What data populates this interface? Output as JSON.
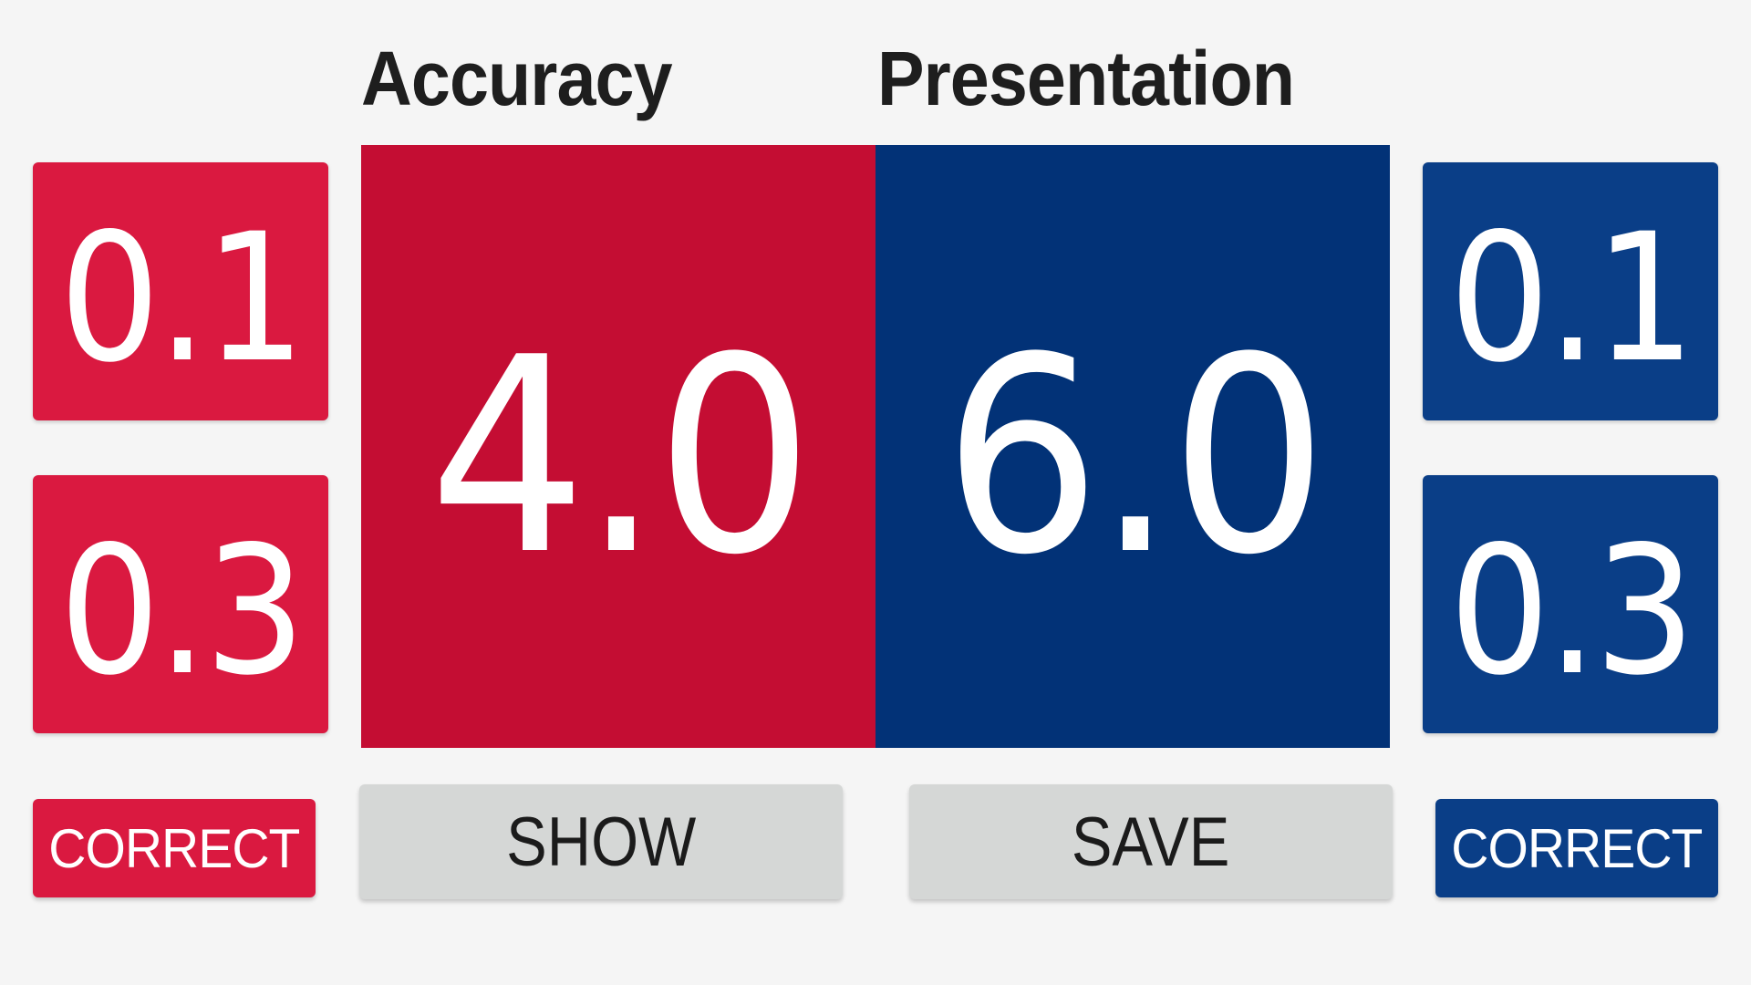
{
  "headings": {
    "accuracy": "Accuracy",
    "presentation": "Presentation"
  },
  "scores": {
    "accuracy": "4.0",
    "presentation": "6.0"
  },
  "deductions": {
    "left": [
      "0.1",
      "0.3"
    ],
    "right": [
      "0.1",
      "0.3"
    ]
  },
  "buttons": {
    "correct_left": "CORRECT",
    "show": "SHOW",
    "save": "SAVE",
    "correct_right": "CORRECT"
  },
  "colors": {
    "accuracy_panel": "#c40d33",
    "presentation_panel": "#023277",
    "red_button": "#da1940",
    "blue_button": "#0a3e87",
    "neutral_button": "#d5d7d6",
    "background": "#f5f5f5"
  }
}
